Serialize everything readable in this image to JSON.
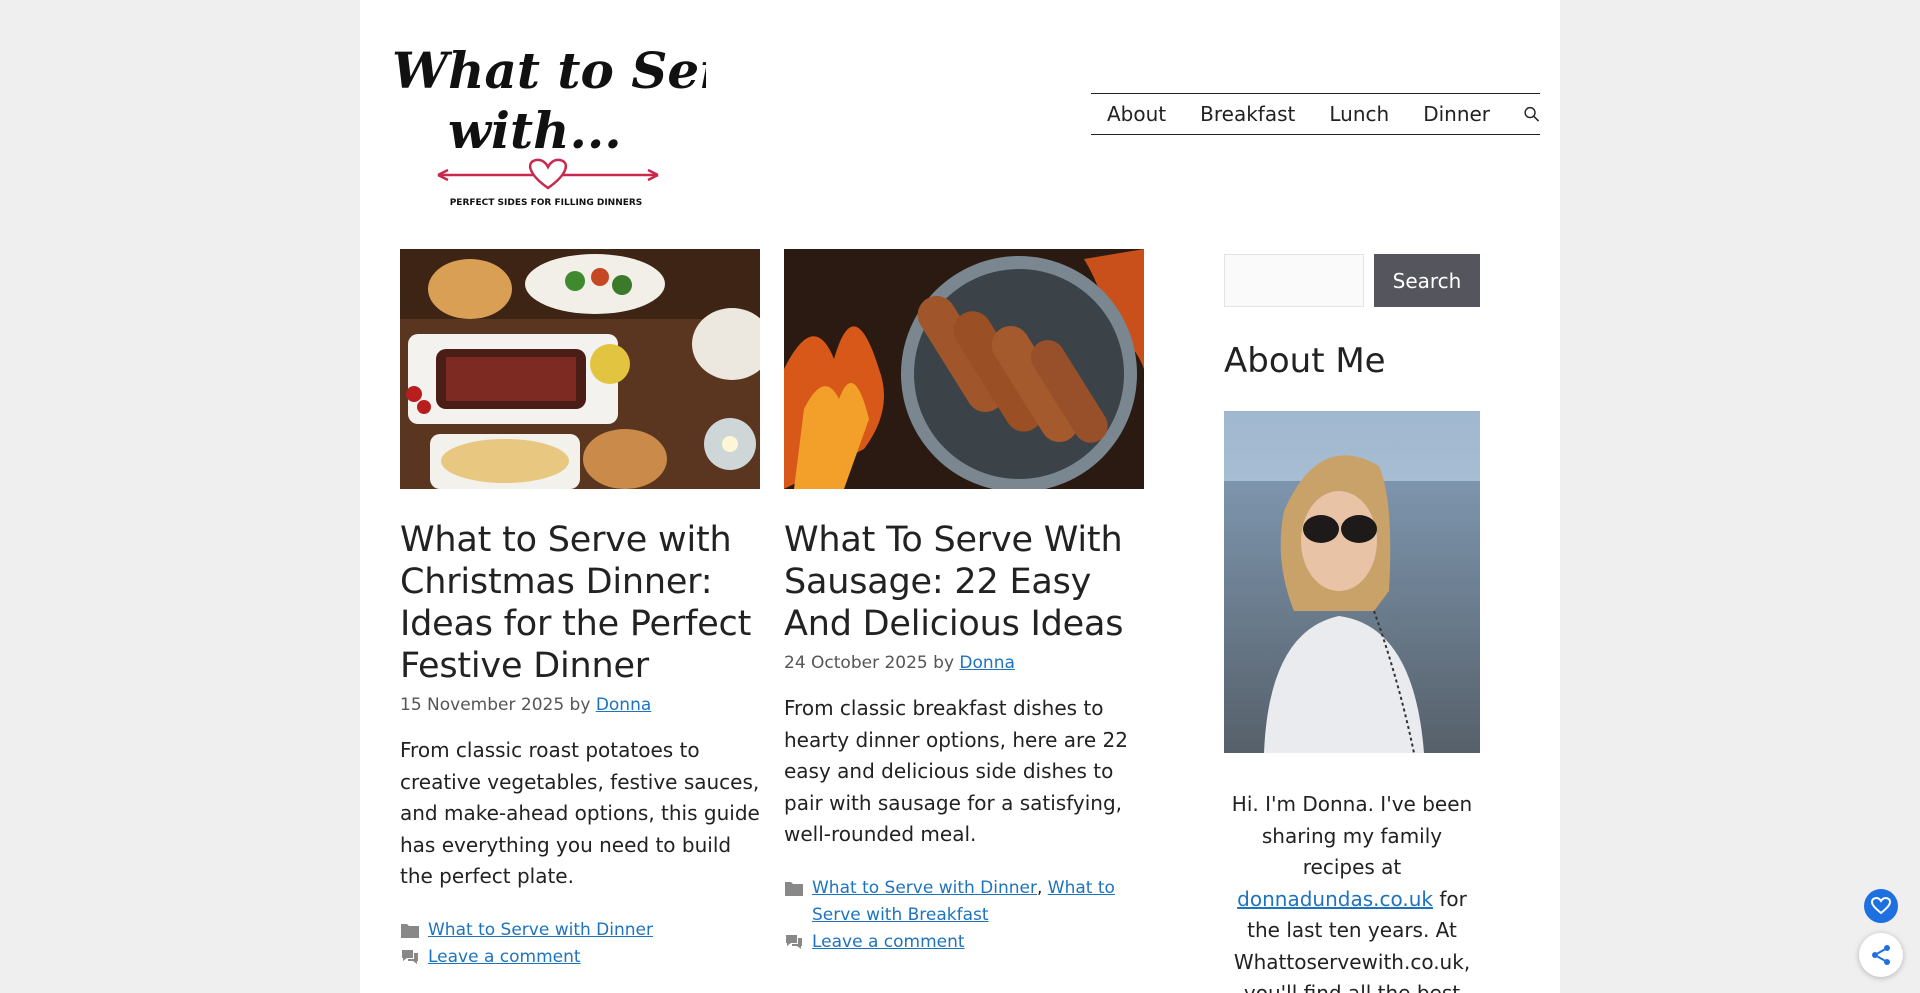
{
  "logo": {
    "line1": "What to Serve",
    "line2": "with...",
    "tagline": "PERFECT SIDES FOR FILLING DINNERS"
  },
  "nav": {
    "items": [
      "About",
      "Breakfast",
      "Lunch",
      "Dinner"
    ],
    "search_icon": "search-icon"
  },
  "posts": [
    {
      "title": "What to Serve with Christmas Dinner: Ideas for the Perfect Festive Dinner",
      "date": "15 November 2025",
      "by": "by",
      "author": "Donna",
      "excerpt": "From classic roast potatoes to creative vegetables, festive sauces, and make-ahead options, this guide has everything you need to build the perfect plate.",
      "categories": [
        "What to Serve with Dinner"
      ],
      "comment": "Leave a comment"
    },
    {
      "title": "What To Serve With Sausage: 22 Easy And Delicious Ideas",
      "date": "24 October 2025",
      "by": "by",
      "author": "Donna",
      "excerpt": "From classic breakfast dishes to hearty dinner options, here are 22 easy and delicious side dishes to pair with sausage for a satisfying, well-rounded meal.",
      "categories": [
        "What to Serve with Dinner",
        "What to Serve with Breakfast"
      ],
      "comment": "Leave a comment"
    }
  ],
  "sidebar": {
    "search_button": "Search",
    "search_placeholder": "",
    "about_title": "About Me",
    "about_intro": "Hi. I'm Donna. I've been sharing my family recipes at",
    "about_link": "donnadundas.co.uk",
    "about_rest": "for the last ten years. At Whattoservewith.co.uk, you'll find all the best sides"
  },
  "colors": {
    "link": "#1e73be",
    "button": "#55555e",
    "heart_fab": "#1e6fe0",
    "logo_accent": "#c8294c"
  }
}
